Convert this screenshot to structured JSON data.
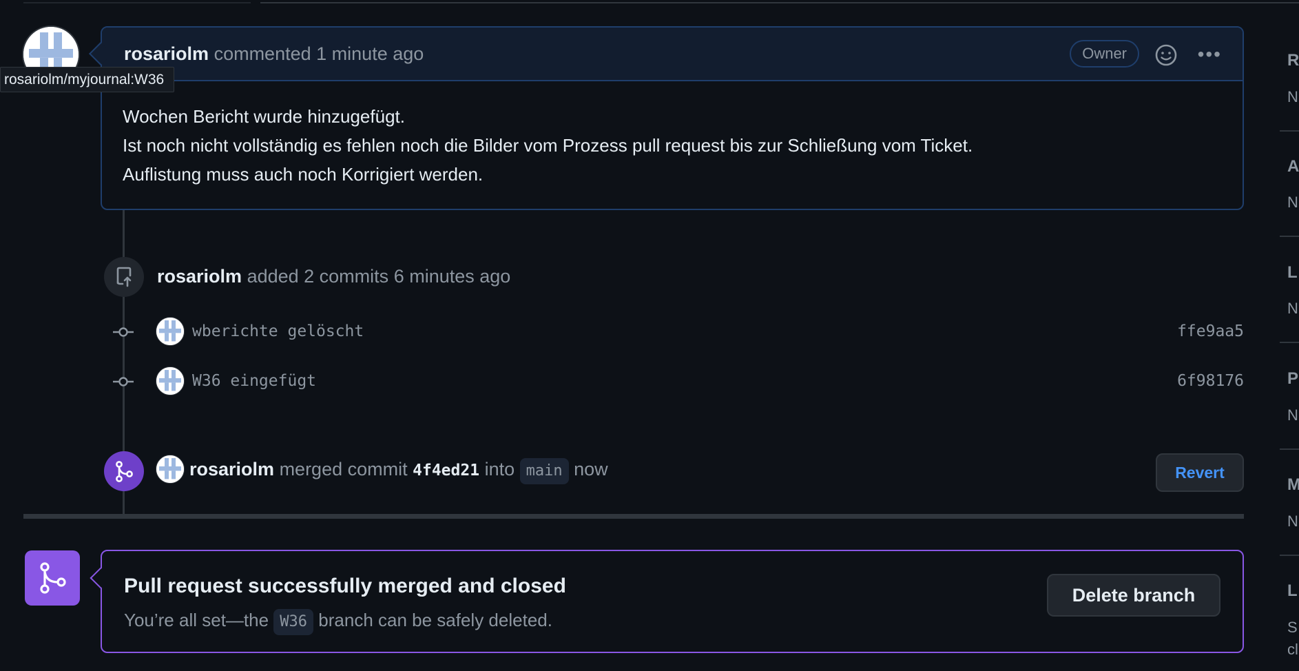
{
  "tooltip": "rosariolm/myjournal:W36",
  "comment": {
    "author": "rosariolm",
    "action": "commented",
    "time": "1 minute ago",
    "badge": "Owner",
    "body": [
      "Wochen Bericht wurde hinzugefügt.",
      "Ist noch nicht vollständig es fehlen noch die Bilder vom Prozess pull request bis zur Schließung vom Ticket.",
      "Auflistung muss auch noch Korrigiert werden."
    ]
  },
  "commits_event": {
    "author": "rosariolm",
    "action": "added 2 commits",
    "time": "6 minutes ago",
    "commits": [
      {
        "message": "wberichte gelöscht",
        "sha": "ffe9aa5"
      },
      {
        "message": "W36 eingefügt",
        "sha": "6f98176"
      }
    ]
  },
  "merge_event": {
    "author": "rosariolm",
    "action": "merged commit",
    "sha": "4f4ed21",
    "into": "into",
    "branch": "main",
    "time": "now",
    "revert_label": "Revert"
  },
  "merged_box": {
    "title": "Pull request successfully merged and closed",
    "sub_prefix": "You’re all set—the",
    "branch": "W36",
    "sub_suffix": "branch can be safely deleted.",
    "delete_label": "Delete branch"
  },
  "sidebar": {
    "letters": [
      "R",
      "A",
      "L",
      "P",
      "M",
      "L"
    ],
    "values": [
      "N",
      "N",
      "N",
      "N",
      "N",
      "S",
      "cl"
    ]
  },
  "colors": {
    "background": "#0d1117",
    "comment_border": "#1f3e6b",
    "merge_purple": "#6e40c9",
    "merged_purple": "#8957e5",
    "link_blue": "#4493f8"
  }
}
